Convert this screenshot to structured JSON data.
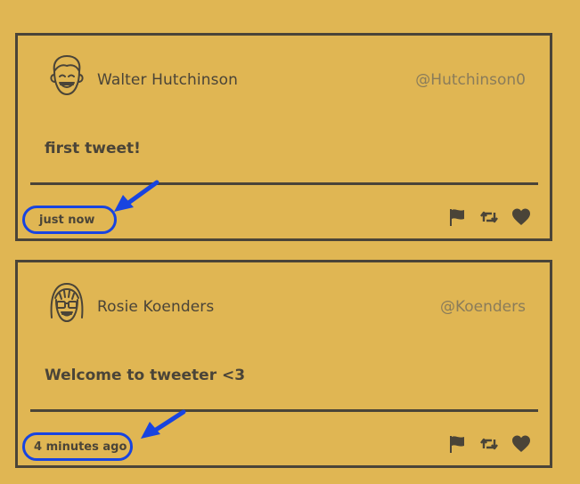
{
  "accent_color": "#1844e0",
  "background_color": "#e0b653",
  "tweets": [
    {
      "avatar_icon": "man-avatar-icon",
      "author_name": "Walter Hutchinson",
      "handle": "@Hutchinson0",
      "content": "first tweet!",
      "timestamp": "just now",
      "actions": [
        "flag-icon",
        "retweet-icon",
        "heart-icon"
      ]
    },
    {
      "avatar_icon": "woman-avatar-icon",
      "author_name": "Rosie Koenders",
      "handle": "@Koenders",
      "content": "Welcome to tweeter <3",
      "timestamp": "4 minutes ago",
      "actions": [
        "flag-icon",
        "retweet-icon",
        "heart-icon"
      ]
    }
  ]
}
